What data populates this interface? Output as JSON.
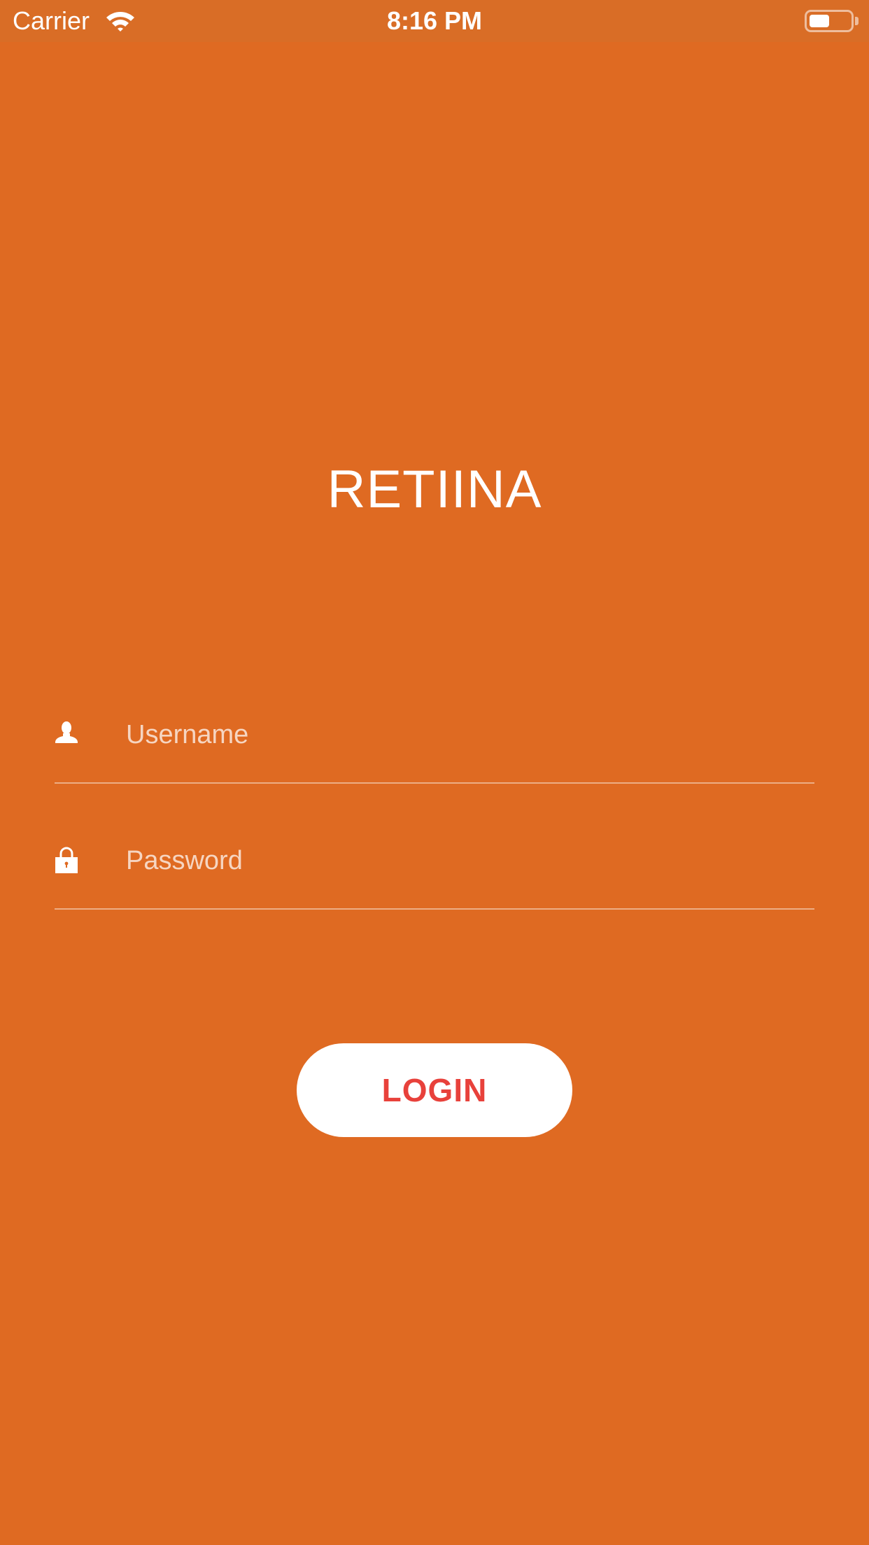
{
  "status_bar": {
    "carrier": "Carrier",
    "time": "8:16 PM",
    "battery_level": 0.5,
    "icons": [
      "wifi-icon",
      "battery-icon"
    ]
  },
  "app": {
    "title": "RETIINA"
  },
  "login_form": {
    "username": {
      "placeholder": "Username",
      "value": "",
      "icon": "user-icon"
    },
    "password": {
      "placeholder": "Password",
      "value": "",
      "icon": "lock-icon"
    },
    "login_button_label": "LOGIN"
  },
  "colors": {
    "background": "#DF6A22",
    "status_bar": "#D96D26",
    "text": "#FFFFFF",
    "button_background": "#FFFFFF",
    "button_text": "#E8413B"
  }
}
